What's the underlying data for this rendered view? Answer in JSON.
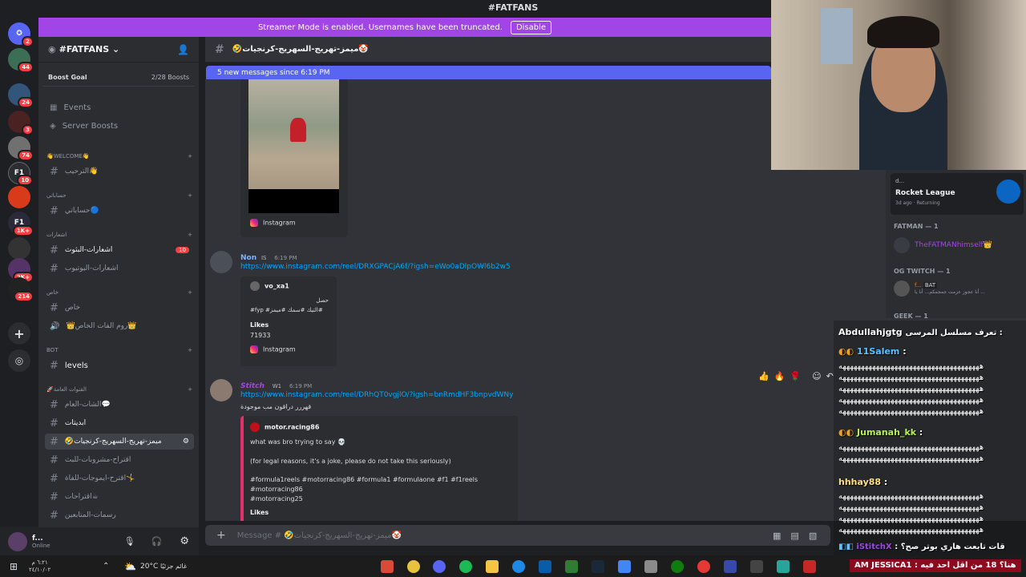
{
  "title": "#FATFANS",
  "streamer_banner": {
    "text": "Streamer Mode is enabled. Usernames have been truncated.",
    "button": "Disable"
  },
  "server_badges": [
    "2",
    "44",
    "24",
    "3",
    "74",
    "10",
    "1K+",
    "2K+",
    "214"
  ],
  "server": {
    "name": "#FATFANS",
    "boost_label": "Boost Goal",
    "boost_value": "2/28 Boosts"
  },
  "channels": {
    "events": "Events",
    "server_boosts": "Server Boosts",
    "cat_welcome": "👋WELCOME👋",
    "ch_welcome": "الترحيب👋",
    "cat_accounts": "حساباتي",
    "ch_accounts": "حساباتي🔵",
    "cat_alerts": "اشعارات",
    "ch_alerts1": "اشعارات-البثوث",
    "alerts1_badge": "10",
    "ch_alerts2": "اشعارات-اليوتيوب",
    "cat_private": "خاص",
    "ch_private": "خاص",
    "ch_room": "👑روم الفات الخاص👑",
    "cat_bot": "BOT",
    "ch_levels": "levels",
    "cat_public": "🚀القنوات العامة",
    "ch_chat": "الشات-العام💬",
    "ch_apps": "ابديتات",
    "ch_active": "🤣ميمز-تهريج-السهريج-كرنجيات",
    "ch_sugg": "اقتراح-مشروبات-للبث",
    "ch_sugg2": "اقترح-ايموجات-للفاة🤸",
    "ch_sugg3": "اقتراحات☕",
    "ch_draw": "رسمات-المتابعين"
  },
  "user": {
    "name": "f...",
    "status": "Online"
  },
  "chat": {
    "header": "🤣ميمز-تهريج-السهريج-كرنجيات🤡",
    "new_messages": "5 new messages since 6:19 PM",
    "embed1_source": "Instagram",
    "msg2": {
      "user": "Non",
      "tag": "IS",
      "time": "6:19 PM",
      "link": "https://www.instagram.com/reel/DRXGPACjA6f/?igsh=eWo0aDlpOWl6b2w5",
      "embed_author": "vo_xa1",
      "embed_line1": "حصل",
      "embed_line2": "#fyp #التيك #سمك #ميمز#",
      "likes_label": "Likes",
      "likes": "71933",
      "source": "Instagram"
    },
    "msg3": {
      "user": "Stitch",
      "tag": "W1",
      "time": "6:19 PM",
      "link": "https://www.instagram.com/reel/DRhQT0vgjlO/?igsh=bnRmdHF3bnpvdWNy",
      "text": "قهررر دراقون مب موجودة",
      "embed_author": "motor.racing86",
      "line1": "what was bro trying to say 💀",
      "line2": "(for legal reasons, it's a joke, please do not take this seriously)",
      "line3": "#formula1reels #motorracing86 #formula1 #formulaone #f1 #f1reels",
      "line4": "#motorracing86",
      "line5": "#motorracing25",
      "likes_label": "Likes"
    },
    "placeholder": "Message # 🤣ميمز-تهريج-السهريج-كرنجيات🤡"
  },
  "members": {
    "activity_user": "d...",
    "activity_game": "Rocket League",
    "activity_time": "3d ago",
    "activity_status": "Returning",
    "cat_fatman": "FATMAN — 1",
    "fatman_name": "TheFATMANhimself👑",
    "cat_og": "OG TWITCH — 1",
    "og_name": "f...",
    "og_tag": "BAT",
    "og_sub": "أنا عجوز عزمت جمجمكم... أنا يا ...",
    "cat_geek": "GEEK — 1"
  },
  "twitch": {
    "l1_user": "Abdullahjgtg",
    "l1_msg": "تعرف مسلسل المرسى :",
    "l2_user": "11Salem",
    "dots": "ههههههههههههههههههههههههههههههههههههههه",
    "l3_user": "Jumanah_kk",
    "l4_user": "hhhay88",
    "l5_user": "iStitchX",
    "l5_msg": "قات تابعت هاري بوتر صح؟",
    "l6_user": "AM JESSICA1",
    "l6_msg": "هنا؟ 18 من اقل احد فيه"
  },
  "taskbar": {
    "weather": "20°C",
    "weather_text": "غائم جزئيًا",
    "time": "٦:٢١ م",
    "date": "٢٤/١٠/٠٢"
  }
}
